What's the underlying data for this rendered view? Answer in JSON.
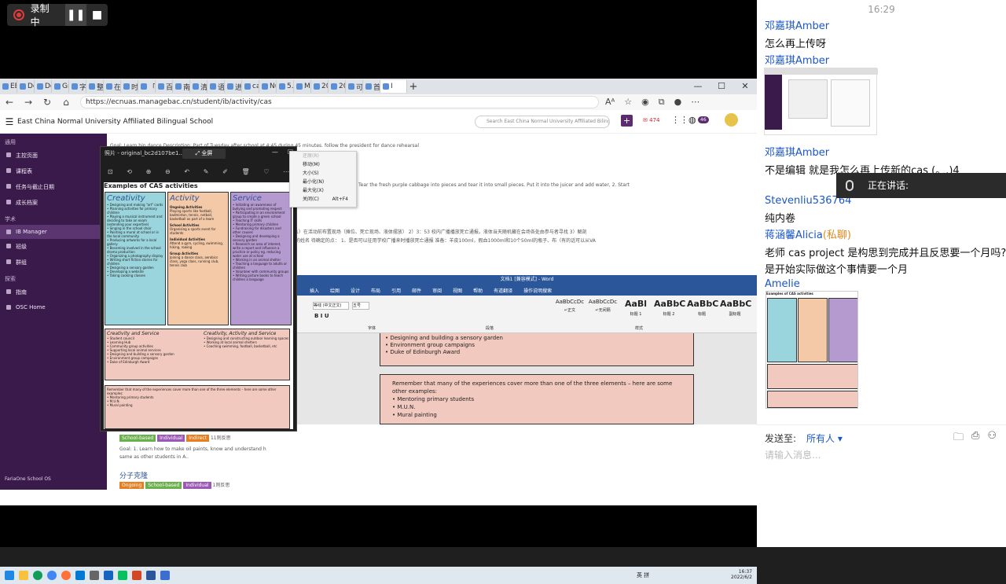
{
  "recorder": {
    "label": "录制中"
  },
  "browser": {
    "tabs": [
      "EE_c",
      "Deep",
      "Deep",
      "Gran",
      "字数",
      "整体",
      "在字",
      "时事",
      "「美",
      "百度",
      "南方",
      "清教",
      "语客",
      "进入",
      "cata",
      "Nutr",
      "5.7 F",
      "Man",
      "2022",
      "2022",
      "可靠",
      "首页"
    ],
    "active_tab": "I",
    "url": "https://ecnuas.managebac.cn/student/ib/activity/cas"
  },
  "managebac": {
    "school": "East China Normal University Affiliated Bilingual School",
    "search_placeholder": "Search East China Normal University Affiliated Biling",
    "mail_count": "474",
    "badge_count": "46",
    "sidebar": {
      "sec1": "通用",
      "items1": [
        "主控页面",
        "课程表",
        "任务与截止日期",
        "成长档案"
      ],
      "sec2": "学术",
      "items2": [
        "IB Manager",
        "班级",
        "群组"
      ],
      "sec3": "探索",
      "items3": [
        "指南",
        "OSC Home"
      ],
      "footer": "FariaOne School OS"
    },
    "content": {
      "goal1": "Goal: Learn hip dance Description: Part of Tuesday after school at 4:45 during 45 minutes. follow the president for dance rehearsal",
      "text2": "Tear the fresh purple cabbage into pieces and tear it into small pieces. Put it into the juicer and add water, 2. Start",
      "text3": "1）在活动前布置现场（摊位、死亡现场、液体摆放） 2）3：53 校内广播播放死亡通报。液体当天随机藏在会场各处由参与者寻找 3）解剖",
      "text4": "的姓名 待确定的点： 1、是否可以征用学校广播来时播放死亡通报 准备：羊皮100ml，假血1000ml和10个50ml的瓶子、布（有的话可以从VA",
      "tags": [
        "School-based",
        "Individual",
        "Indirect",
        "11则反思"
      ],
      "goal2": "Goal: 1. Learn how to make oil paints, know and understand h",
      "goal2b": "same as other students in A..",
      "title3": "分子克隆",
      "tags3": [
        "Ongoing",
        "School-based",
        "Individual",
        "1则反思"
      ]
    }
  },
  "photo_viewer": {
    "title": "照片 - original_bc2d107be1...",
    "fullscreen": "全屏",
    "heading": "Examples of CAS activities",
    "creativity": {
      "title": "Creativity",
      "items": [
        "Designing and making \"art\" cards",
        "Planning activities for primary children",
        "Playing a musical instrument and deciding to take an exam (extending your expertise)",
        "Singing in the school choir",
        "Painting a mural at school or in the local community",
        "Producing artworks for a local gallery",
        "Becoming involved in the school drama production",
        "Organizing a photography display",
        "Writing short fiction stories for children",
        "Designing a sensory garden",
        "Developing a website",
        "Taking cooking classes"
      ]
    },
    "activity": {
      "title": "Activity",
      "ongoing_h": "Ongoing Activities",
      "ongoing": [
        "Playing sports like football, badminton, tennis, netball, basketball as part of a team"
      ],
      "school_h": "School Activities",
      "school": [
        "Organizing a sports event for students"
      ],
      "individual_h": "Individual Activities",
      "individual": [
        "Attend a gym, cycling, swimming, hiking, rowing"
      ],
      "group_h": "Group Activities",
      "group": [
        "Joining a dance class, aerobics class, yoga class, running club, tennis club"
      ]
    },
    "service": {
      "title": "Service",
      "items": [
        "Initiating an awareness of bullying and promoting respect",
        "Participating in an environment group to create a green school",
        "Teaching IT skills",
        "Mentoring primary children",
        "Fundraising for disasters and other causes",
        "Designing and developing a sensory garden",
        "Research an area of interest, write a report and influence a practice or policy eg. reducing water use at school",
        "Working in an animal shelter",
        "Teaching a language to adults or children",
        "Volunteer with community groups",
        "Writing picture books to teach children a language"
      ]
    },
    "cs": {
      "title": "Creativity and Service",
      "items": [
        "Student council",
        "Learning Hub",
        "Community group activities",
        "Supporting local animal services",
        "Designing and building a sensory garden",
        "Environment group campaigns",
        "Duke of Edinburgh Award"
      ]
    },
    "cas": {
      "title": "Creativity, Activity and Service",
      "items": [
        "Designing and constructing outdoor learning spaces",
        "Working at local animal shelters",
        "Coaching swimming, football, basketball, etc"
      ]
    },
    "remember": "Remember that many of the experiences cover more than one of the three elements – here are some other examples:",
    "remember_items": [
      "Mentoring primary students",
      "M.U.N.",
      "Mural painting"
    ]
  },
  "context_menu": {
    "items": [
      "还原(R)",
      "移动(M)",
      "大小(S)",
      "最小化(N)",
      "最大化(X)",
      "关闭(C)"
    ],
    "shortcut": "Alt+F4"
  },
  "word": {
    "title": "文档1 [兼容模式] - Word",
    "menu": [
      "插入",
      "绘图",
      "设计",
      "布局",
      "引用",
      "邮件",
      "审阅",
      "视图",
      "帮助",
      "有道翻译",
      "操作说明搜索"
    ],
    "font": "等线 (中文正文)",
    "size": "五号",
    "styles": [
      {
        "sample": "AaBbCcDc",
        "label": "↵正文"
      },
      {
        "sample": "AaBbCcDc",
        "label": "↵无间隔"
      },
      {
        "sample": "AaBl",
        "label": "标题 1"
      },
      {
        "sample": "AaBbC",
        "label": "标题 2"
      },
      {
        "sample": "AaBbC",
        "label": "标题"
      },
      {
        "sample": "AaBbC",
        "label": "副标题"
      }
    ],
    "groups": [
      "字体",
      "段落",
      "样式"
    ],
    "page1": [
      "Designing and building a sensory garden",
      "Environment group campaigns",
      "Duke of Edinburgh Award"
    ],
    "page2_text": "Remember that many of the experiences cover more than one of the three elements – here are some other examples:",
    "page2_items": [
      "Mentoring primary students",
      "M.U.N.",
      "Mural painting"
    ]
  },
  "taskbar": {
    "lang1": "英",
    "lang2": "拼",
    "time": "16:37",
    "date": "2022/6/2"
  },
  "chat": {
    "time": "16:29",
    "messages": [
      {
        "name": "邓嘉琪Amber",
        "text": "怎么再上传呀"
      },
      {
        "name": "邓嘉琪Amber",
        "text": ""
      },
      {
        "name": "邓嘉琪Amber",
        "text": "不是编辑 就是我怎么再上传新的cas (。.)4"
      },
      {
        "name": "Stevenliu536764",
        "text": "纯内卷"
      },
      {
        "name": "蒋涵馨Alicia",
        "tag": "(私聊)",
        "text": "老师 cas project 是构思到完成并且反思要一个月吗? 这",
        "text2": "是开始实际做这个事情要一个月"
      },
      {
        "name": "Amelie",
        "text": ""
      }
    ],
    "speaking": "正在讲话:",
    "send_to": "发送至:",
    "send_target": "所有人",
    "input_placeholder": "请输入消息..."
  }
}
